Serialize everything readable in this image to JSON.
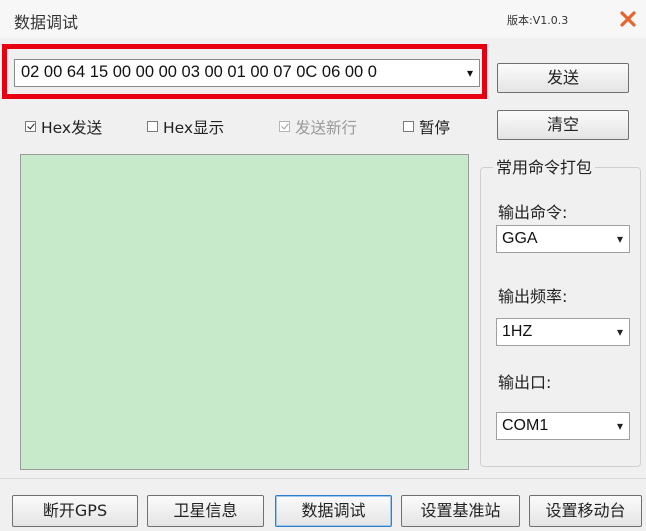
{
  "window": {
    "title": "数据调试",
    "version": "版本:V1.0.3"
  },
  "command": {
    "value": "02 00 64 15 00 00 00 03 00 01 00 07 0C 06 00 0"
  },
  "buttons": {
    "send": "发送",
    "clear": "清空"
  },
  "options": {
    "hex_send": {
      "label": "Hex发送",
      "checked": true
    },
    "hex_display": {
      "label": "Hex显示",
      "checked": false
    },
    "send_newline": {
      "label": "发送新行",
      "checked": true,
      "disabled": true
    },
    "pause": {
      "label": "暂停",
      "checked": false
    }
  },
  "pack_group": {
    "title": "常用命令打包",
    "output_command_label": "输出命令:",
    "output_command_value": "GGA",
    "output_rate_label": "输出频率:",
    "output_rate_value": "1HZ",
    "output_port_label": "输出口:",
    "output_port_value": "COM1"
  },
  "tabs": [
    {
      "label": "断开GPS"
    },
    {
      "label": "卫星信息"
    },
    {
      "label": "数据调试"
    },
    {
      "label": "设置基准站"
    },
    {
      "label": "设置移动台"
    }
  ],
  "colors": {
    "data_area": "#c7eacb",
    "highlight": "#e60012",
    "close_icon": "#e8642c"
  },
  "icons": {
    "close": "close-icon",
    "dropdown": "chevron-down-icon"
  }
}
